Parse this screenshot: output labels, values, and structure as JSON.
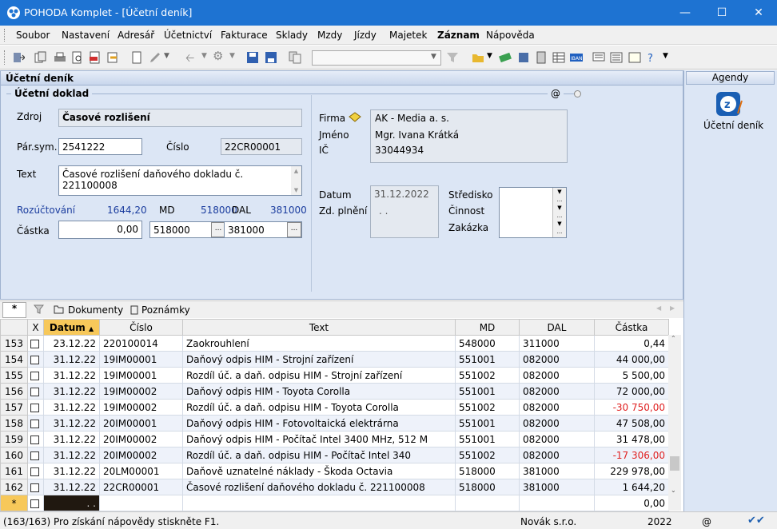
{
  "window": {
    "title": "POHODA Komplet - [Účetní deník]"
  },
  "menu": [
    "Soubor",
    "Nastavení",
    "Adresář",
    "Účetnictví",
    "Fakturace",
    "Sklady",
    "Mzdy",
    "Jízdy",
    "Majetek",
    "Záznam",
    "Nápověda"
  ],
  "panel": {
    "header": "Účetní deník",
    "section": "Účetní doklad",
    "at_icon": "@"
  },
  "form": {
    "zdroj_label": "Zdroj",
    "zdroj_value": "Časové rozlišení",
    "parsym_label": "Pár.sym.",
    "parsym_value": "2541222",
    "cislo_label": "Číslo",
    "cislo_value": "22CR00001",
    "text_label": "Text",
    "text_value": "Časové rozlišení daňového dokladu č. 221100008",
    "rozuct_label": "Rozúčtování",
    "rozuct_value": "1644,20",
    "md_label": "MD",
    "md_value": "518000",
    "dal_label": "DAL",
    "dal_value": "381000",
    "castka_label": "Částka",
    "castka_value": "0,00",
    "md_field": "518000",
    "dal_field": "381000",
    "firma_label": "Firma",
    "firma_value": "AK - Media a. s.",
    "jmeno_label": "Jméno",
    "jmeno_value": "Mgr. Ivana Krátká",
    "ic_label": "IČ",
    "ic_value": "33044934",
    "datum_label": "Datum",
    "datum_value": "31.12.2022",
    "zdplneni_label": "Zd. plnění",
    "zdplneni_value": ". .",
    "stredisko_label": "Středisko",
    "cinnost_label": "Činnost",
    "zakazka_label": "Zakázka"
  },
  "agenda": {
    "header": "Agendy",
    "item": "Účetní deník"
  },
  "tabs": {
    "star": "*",
    "dokumenty": "Dokumenty",
    "poznamky": "Poznámky"
  },
  "table": {
    "columns": [
      "X",
      "Datum",
      "Číslo",
      "Text",
      "MD",
      "DAL",
      "Částka"
    ],
    "rows": [
      {
        "n": "153",
        "date": "23.12.22",
        "num": "220100014",
        "text": "Zaokrouhlení",
        "md": "548000",
        "dal": "311000",
        "amt": "0,44",
        "neg": false
      },
      {
        "n": "154",
        "date": "31.12.22",
        "num": "19IM00001",
        "text": "Daňový odpis HIM - Strojní zařízení",
        "md": "551001",
        "dal": "082000",
        "amt": "44 000,00",
        "neg": false
      },
      {
        "n": "155",
        "date": "31.12.22",
        "num": "19IM00001",
        "text": "Rozdíl úč. a daň. odpisu HIM - Strojní zařízení",
        "md": "551002",
        "dal": "082000",
        "amt": "5 500,00",
        "neg": false
      },
      {
        "n": "156",
        "date": "31.12.22",
        "num": "19IM00002",
        "text": "Daňový odpis HIM - Toyota Corolla",
        "md": "551001",
        "dal": "082000",
        "amt": "72 000,00",
        "neg": false
      },
      {
        "n": "157",
        "date": "31.12.22",
        "num": "19IM00002",
        "text": "Rozdíl úč. a daň. odpisu HIM - Toyota Corolla",
        "md": "551002",
        "dal": "082000",
        "amt": "-30 750,00",
        "neg": true
      },
      {
        "n": "158",
        "date": "31.12.22",
        "num": "20IM00001",
        "text": "Daňový odpis HIM - Fotovoltaická elektrárna",
        "md": "551001",
        "dal": "082000",
        "amt": "47 508,00",
        "neg": false
      },
      {
        "n": "159",
        "date": "31.12.22",
        "num": "20IM00002",
        "text": "Daňový odpis HIM - Počítač Intel 3400 MHz, 512 M",
        "md": "551001",
        "dal": "082000",
        "amt": "31 478,00",
        "neg": false
      },
      {
        "n": "160",
        "date": "31.12.22",
        "num": "20IM00002",
        "text": "Rozdíl úč. a daň. odpisu HIM - Počítač Intel 340",
        "md": "551002",
        "dal": "082000",
        "amt": "-17 306,00",
        "neg": true
      },
      {
        "n": "161",
        "date": "31.12.22",
        "num": "20LM00001",
        "text": "Daňově uznatelné náklady - Škoda Octavia",
        "md": "518000",
        "dal": "381000",
        "amt": "229 978,00",
        "neg": false
      },
      {
        "n": "162",
        "date": "31.12.22",
        "num": "22CR00001",
        "text": "Časové rozlišení daňového dokladu č. 221100008",
        "md": "518000",
        "dal": "381000",
        "amt": "1 644,20",
        "neg": false
      }
    ],
    "new_row": {
      "n": "*",
      "date": ". .",
      "amt": "0,00"
    }
  },
  "status": {
    "left": "(163/163) Pro získání nápovědy stiskněte F1.",
    "company": "Novák s.r.o.",
    "year": "2022",
    "at": "@"
  }
}
